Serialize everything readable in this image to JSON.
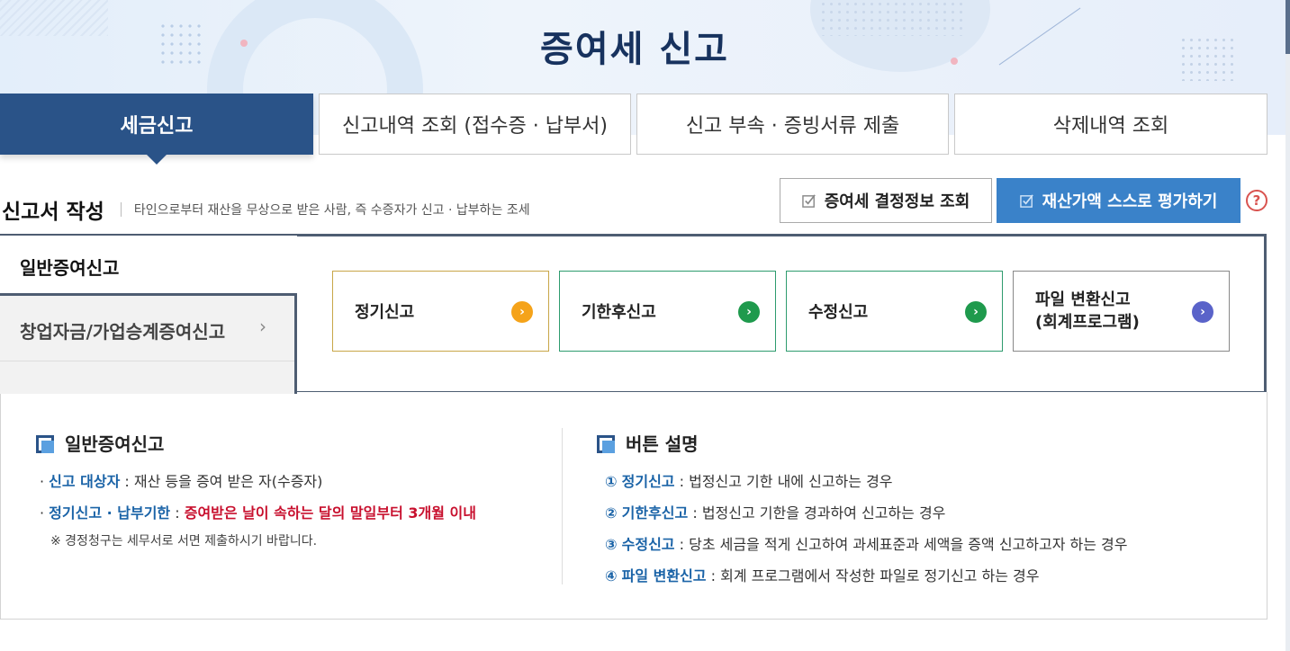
{
  "page": {
    "title": "증여세 신고"
  },
  "tabs": [
    {
      "label": "세금신고"
    },
    {
      "label": "신고내역 조회 (접수증 · 납부서)"
    },
    {
      "label": "신고 부속 · 증빙서류 제출"
    },
    {
      "label": "삭제내역 조회"
    }
  ],
  "section": {
    "heading": "신고서 작성",
    "description": "타인으로부터 재산을 무상으로 받은 사람, 즉 수증자가 신고 · 납부하는 조세"
  },
  "actions": {
    "decision_info": "증여세 결정정보 조회",
    "self_assessment": "재산가액 스스로 평가하기",
    "help": "?"
  },
  "sidebar": {
    "active": "일반증여신고",
    "inactive": "창업자금/가업승계증여신고",
    "chevron": "›"
  },
  "cards": [
    {
      "label": "정기신고",
      "color": "#f5a31a"
    },
    {
      "label": "기한후신고",
      "color": "#1f9a4d"
    },
    {
      "label": "수정신고",
      "color": "#1f9a4d"
    },
    {
      "label_line1": "파일 변환신고",
      "label_line2": "(회계프로그램)",
      "color": "#5a63c9"
    }
  ],
  "general": {
    "title": "일반증여신고",
    "item1_key": "신고 대상자",
    "item1_val": " : 재산 등을 증여 받은 자(수증자)",
    "item2_key": "정기신고 · 납부기한",
    "item2_sep": " : ",
    "item2_val": "증여받은 날이 속하는 달의 말일부터 3개월 이내",
    "note": "※ 경정청구는 세무서로 서면 제출하시기 바랍니다."
  },
  "buttons_desc": {
    "title": "버튼 설명",
    "items": [
      {
        "num": "①",
        "key": "정기신고",
        "val": " : 법정신고 기한 내에 신고하는 경우"
      },
      {
        "num": "②",
        "key": "기한후신고",
        "val": " : 법정신고 기한을 경과하여 신고하는 경우"
      },
      {
        "num": "③",
        "key": "수정신고",
        "val": " : 당초 세금을 적게 신고하여 과세표준과 세액을 증액 신고하고자 하는 경우"
      },
      {
        "num": "④",
        "key": "파일 변환신고",
        "val": " : 회계 프로그램에서 작성한 파일로 정기신고 하는 경우"
      }
    ]
  }
}
